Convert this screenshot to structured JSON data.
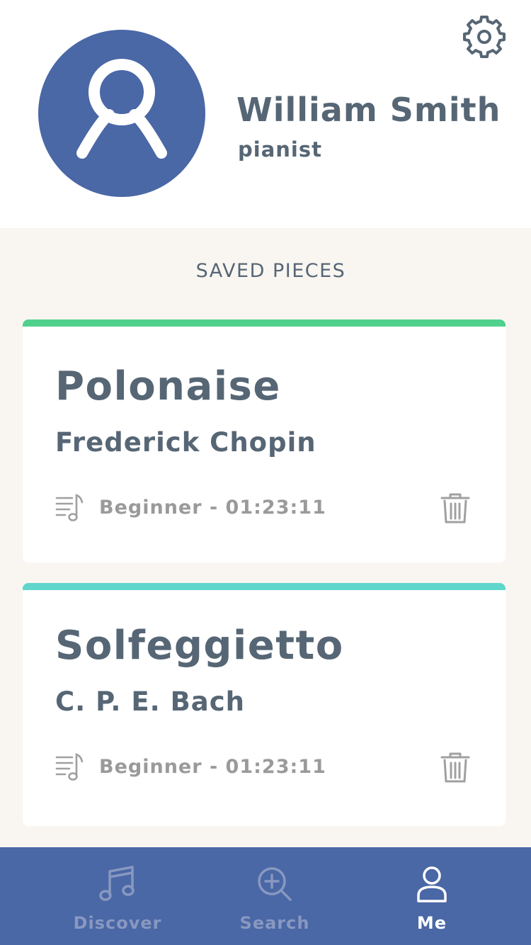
{
  "profile": {
    "name": "William Smith",
    "role": "pianist"
  },
  "icons": {
    "settings": "gear-icon",
    "avatar": "user-icon",
    "sheet_music": "sheet-music-icon",
    "delete": "trash-icon",
    "discover": "music-note-icon",
    "search": "zoom-in-icon",
    "me": "person-icon"
  },
  "saved": {
    "heading": "SAVED PIECES",
    "pieces": [
      {
        "title": "Polonaise",
        "composer": "Frederick Chopin",
        "meta": "Beginner - 01:23:11",
        "accent": "#4fd18b"
      },
      {
        "title": "Solfeggietto",
        "composer": "C. P. E. Bach",
        "meta": "Beginner - 01:23:11",
        "accent": "#5fd6cc"
      }
    ]
  },
  "tabs": [
    {
      "label": "Discover",
      "active": false
    },
    {
      "label": "Search",
      "active": false
    },
    {
      "label": "Me",
      "active": true
    }
  ],
  "colors": {
    "brand": "#4a67a6",
    "text": "#566675",
    "muted": "#9a9a9a",
    "background": "#f9f6f2"
  }
}
